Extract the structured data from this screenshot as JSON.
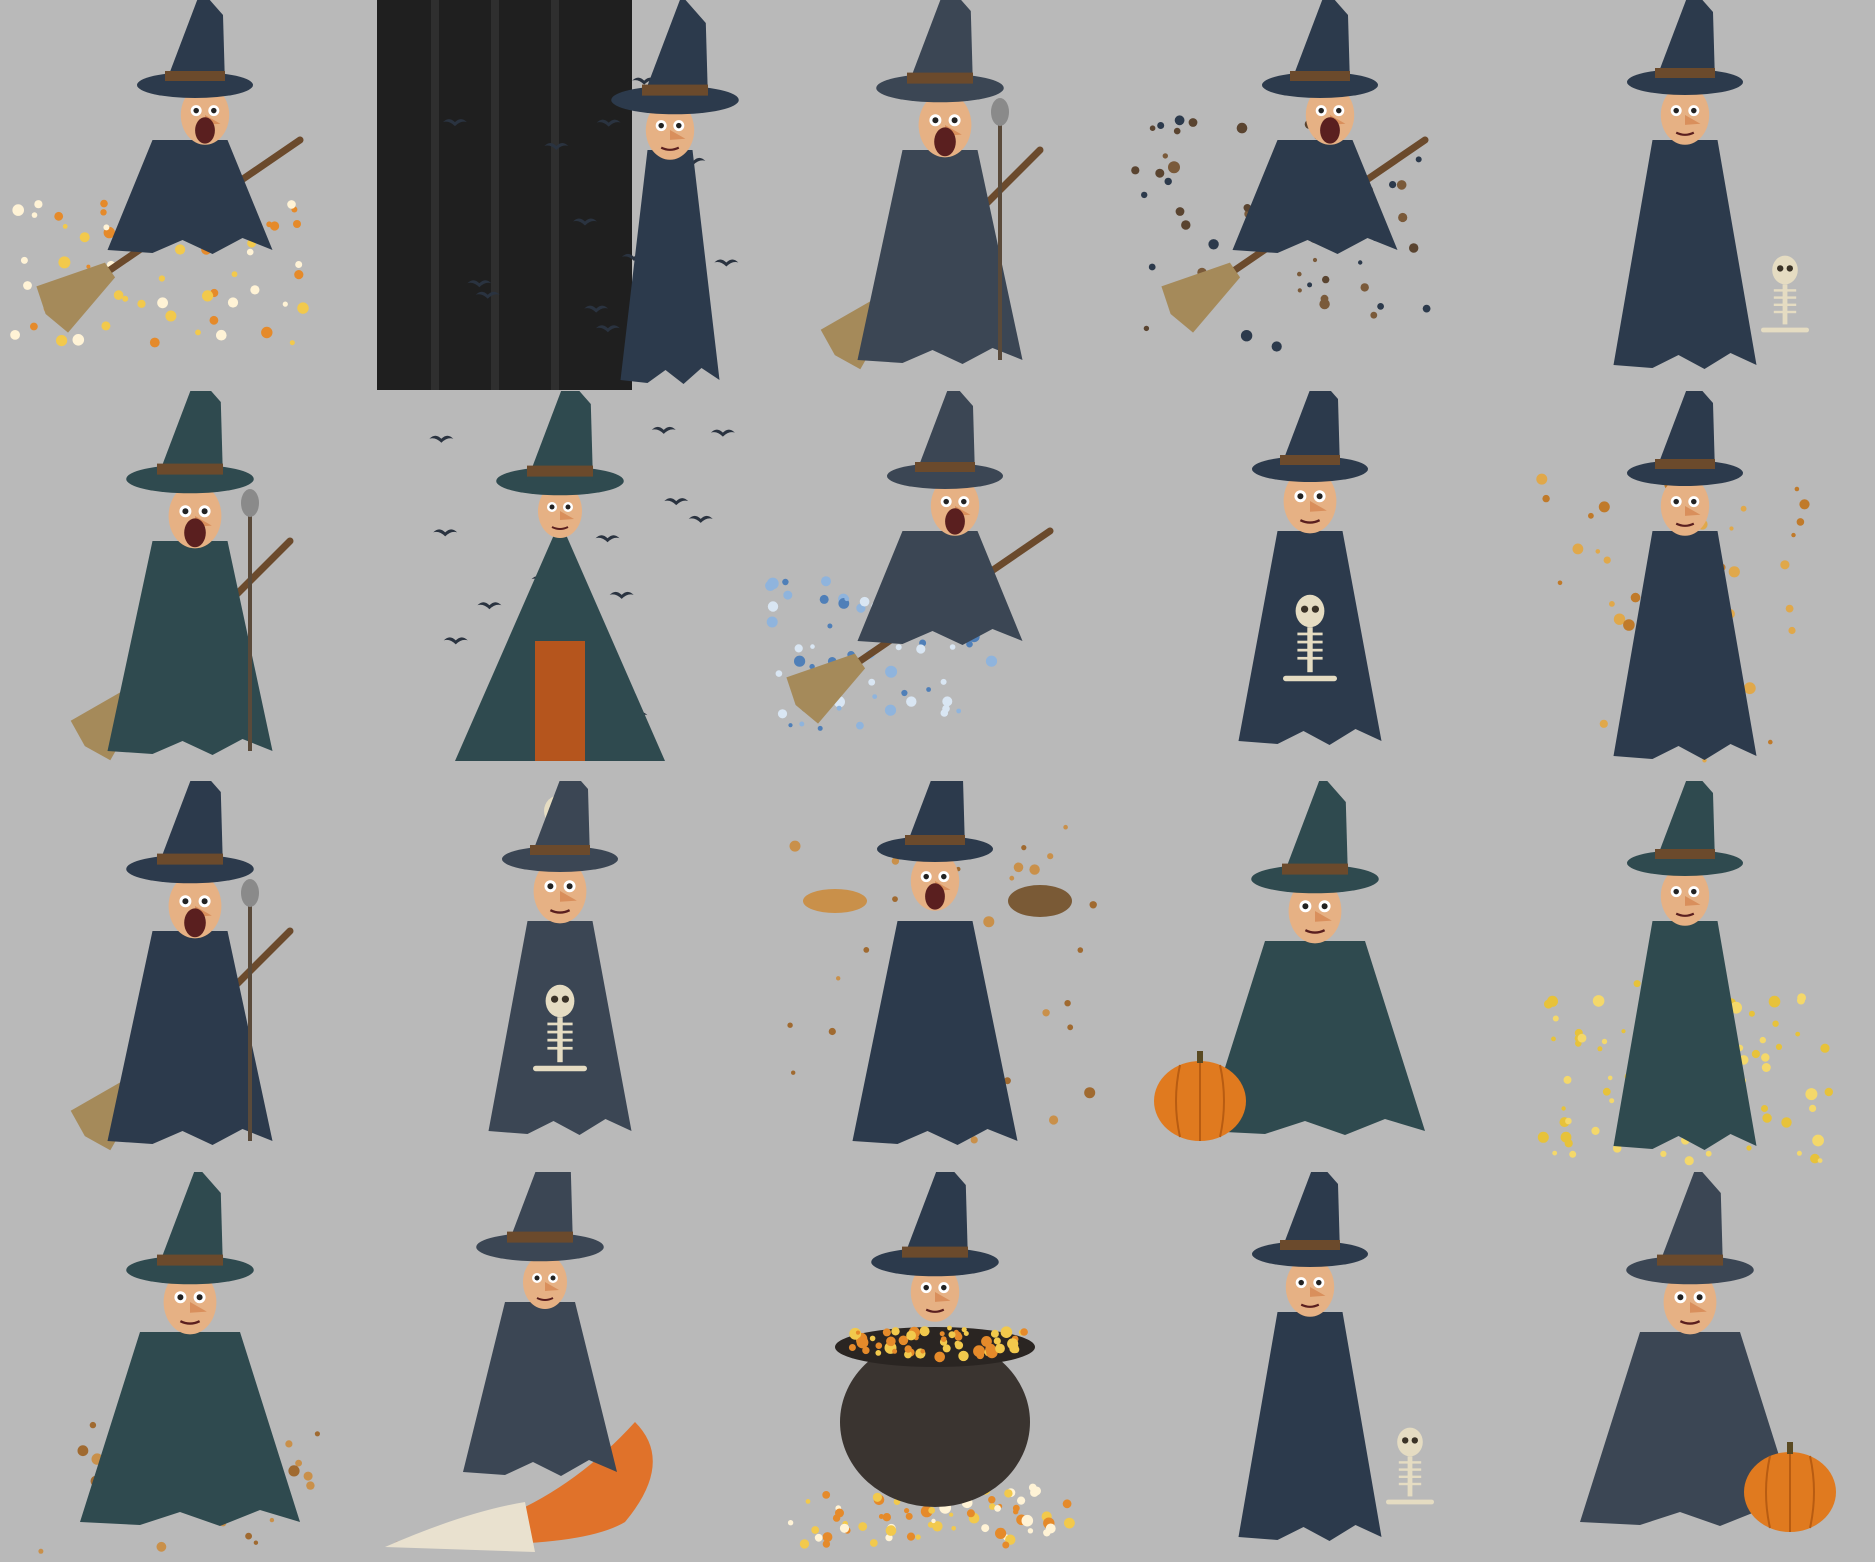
{
  "background_color": "#b9b9b9",
  "palette": {
    "robe_navy": "#2c3a4c",
    "robe_teal": "#2f4a4f",
    "robe_slate": "#3b4654",
    "skin": "#e6b184",
    "broom_straw": "#a58a5a",
    "broom_handle": "#6b4a2c",
    "candy_corn_orange": "#e58a2a",
    "candy_corn_yellow": "#f2c94c",
    "pumpkin": "#e07a1f",
    "bone": "#e5dcc2",
    "curtain_black": "#1f1f1f",
    "spaghetti_yellow": "#e7c23a"
  },
  "tiles": [
    {
      "kind": "broom-rider",
      "robe": "robe_navy",
      "prop": "candy-corn"
    },
    {
      "kind": "curtain-peek",
      "robe": "robe_navy",
      "prop": "bats"
    },
    {
      "kind": "singer",
      "robe": "robe_slate",
      "prop": "broom"
    },
    {
      "kind": "broom-rider",
      "robe": "robe_navy",
      "prop": "dust"
    },
    {
      "kind": "standing",
      "robe": "robe_navy",
      "prop": "skeleton"
    },
    {
      "kind": "singer",
      "robe": "robe_teal",
      "prop": "broom"
    },
    {
      "kind": "caped",
      "robe": "robe_teal",
      "prop": "bats"
    },
    {
      "kind": "broom-rider",
      "robe": "robe_slate",
      "prop": "water"
    },
    {
      "kind": "seated",
      "robe": "robe_navy",
      "prop": "skeleton"
    },
    {
      "kind": "standing",
      "robe": "robe_navy",
      "prop": "sparks"
    },
    {
      "kind": "singer",
      "robe": "robe_navy",
      "prop": "broom"
    },
    {
      "kind": "seated",
      "robe": "robe_slate",
      "prop": "skull-hat"
    },
    {
      "kind": "juggler",
      "robe": "robe_navy",
      "prop": "cookies"
    },
    {
      "kind": "crouching",
      "robe": "robe_teal",
      "prop": "pumpkin"
    },
    {
      "kind": "standing",
      "robe": "robe_teal",
      "prop": "spaghetti"
    },
    {
      "kind": "crouching",
      "robe": "robe_teal",
      "prop": "cookies"
    },
    {
      "kind": "surfer",
      "robe": "robe_slate",
      "prop": "orange-peel"
    },
    {
      "kind": "cauldron",
      "robe": "robe_navy",
      "prop": "candy-corn"
    },
    {
      "kind": "standing",
      "robe": "robe_navy",
      "prop": "skeleton"
    },
    {
      "kind": "crouching",
      "robe": "robe_slate",
      "prop": "pumpkin"
    }
  ]
}
